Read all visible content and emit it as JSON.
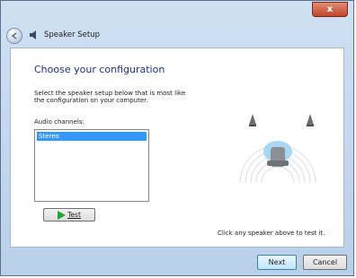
{
  "window": {
    "close_glyph": "x"
  },
  "nav": {
    "title": "Speaker Setup"
  },
  "content": {
    "heading": "Choose your configuration",
    "description": "Select the speaker setup below that is most like\nthe configuration on your computer.",
    "channels_label": "Audio channels:",
    "channels": [
      {
        "label": "Stereo",
        "selected": true
      }
    ],
    "test_button": "Test",
    "hint": "Click any speaker above to test it."
  },
  "footer": {
    "next_button": "Next",
    "cancel_button": "Cancel"
  },
  "colors": {
    "accent": "#3399ff",
    "heading": "#1e3287",
    "close": "#c2452d"
  }
}
